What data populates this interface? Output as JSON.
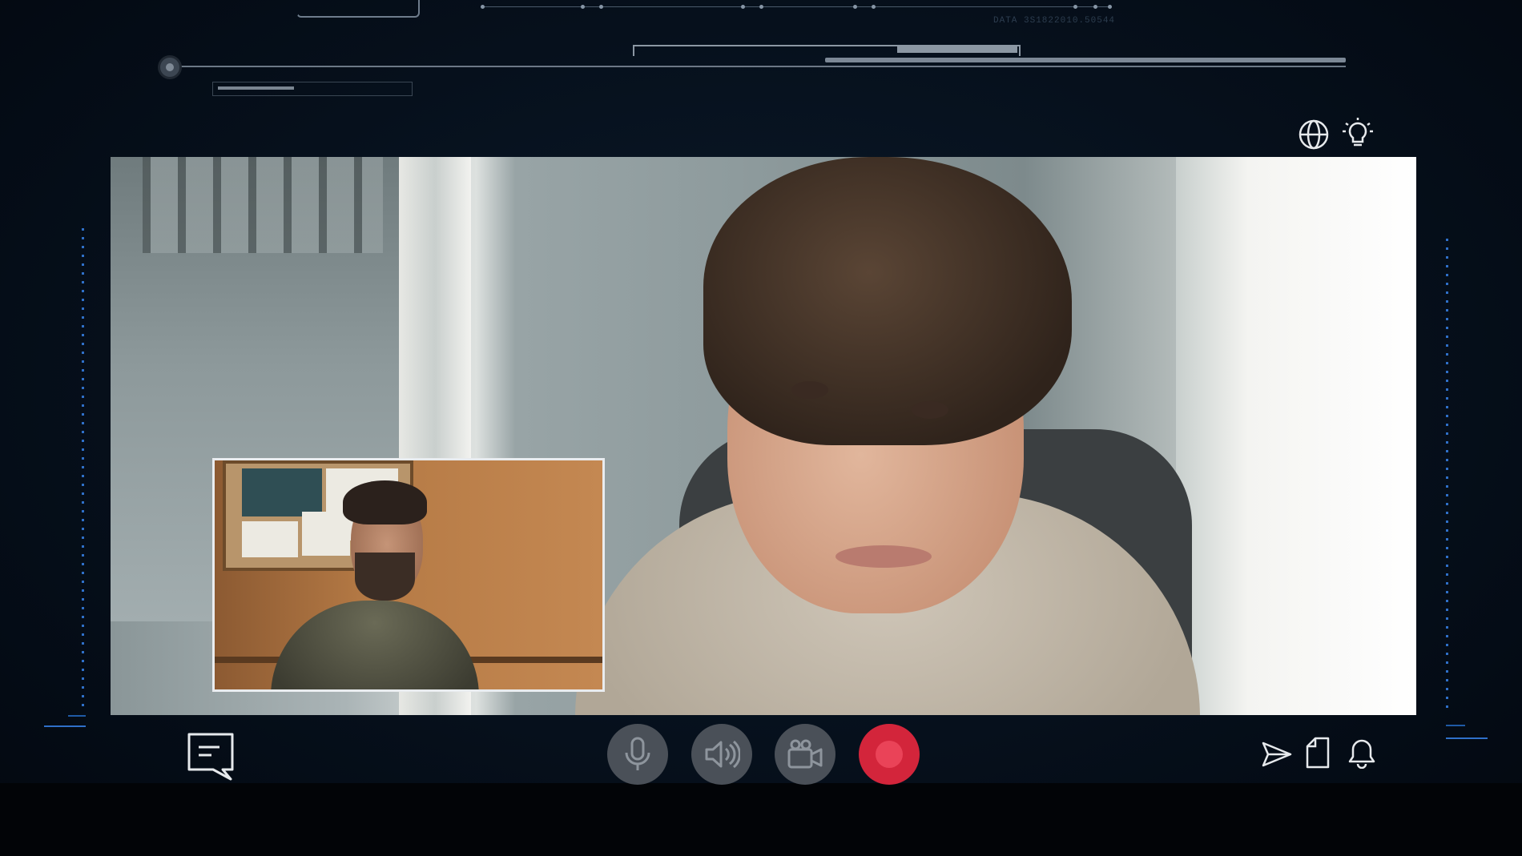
{
  "hud": {
    "data_label": "DATA  3S1822010.50544"
  },
  "toolbar_top": {
    "globe_icon": "globe-icon",
    "lightbulb_icon": "lightbulb-icon"
  },
  "call": {
    "main_participant": "remote-video",
    "self_view": "local-video"
  },
  "controls": {
    "chat_icon": "chat-icon",
    "mic_icon": "microphone-icon",
    "speaker_icon": "speaker-icon",
    "camera_icon": "camera-icon",
    "record_icon": "record-icon",
    "send_icon": "send-icon",
    "document_icon": "document-icon",
    "bell_icon": "bell-icon"
  },
  "colors": {
    "accent_blue": "#2f70c9",
    "record_red": "#d3253b",
    "control_gray": "#4a5058",
    "icon_light": "#e6e9ec"
  }
}
